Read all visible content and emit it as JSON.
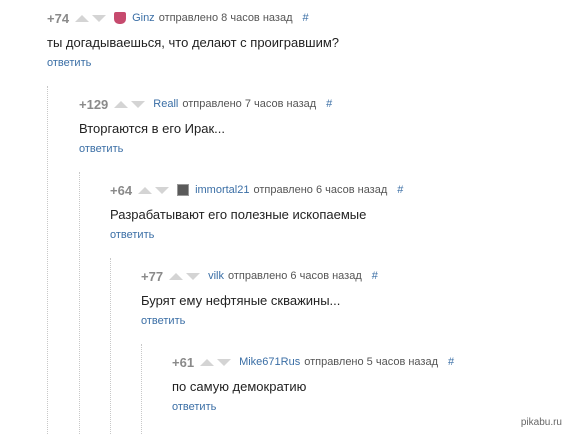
{
  "comments": [
    {
      "rating": "+74",
      "author": "Ginz",
      "posted": "отправлено 8 часов назад",
      "hash": "#",
      "text": "ты догадываешься, что делают с проигравшим?",
      "reply": "ответить"
    },
    {
      "rating": "+129",
      "author": "Reall",
      "posted": "отправлено 7 часов назад",
      "hash": "#",
      "text": "Вторгаются в его Ирак...",
      "reply": "ответить"
    },
    {
      "rating": "+64",
      "author": "immortal21",
      "posted": "отправлено 6 часов назад",
      "hash": "#",
      "text": "Разрабатывают его полезные ископаемые",
      "reply": "ответить"
    },
    {
      "rating": "+77",
      "author": "vilk",
      "posted": "отправлено 6 часов назад",
      "hash": "#",
      "text": "Бурят ему нефтяные скважины...",
      "reply": "ответить"
    },
    {
      "rating": "+61",
      "author": "Mike671Rus",
      "posted": "отправлено 5 часов назад",
      "hash": "#",
      "text": "по самую демократию",
      "reply": "ответить"
    }
  ],
  "watermark": "pikabu.ru",
  "icons": {
    "upvote": "arrow-up-icon",
    "downvote": "arrow-down-icon",
    "avatar": "avatar-icon"
  },
  "colors": {
    "link": "#3a6ea5",
    "rating": "#8a8a8a",
    "vote": "#d4d4d4"
  }
}
